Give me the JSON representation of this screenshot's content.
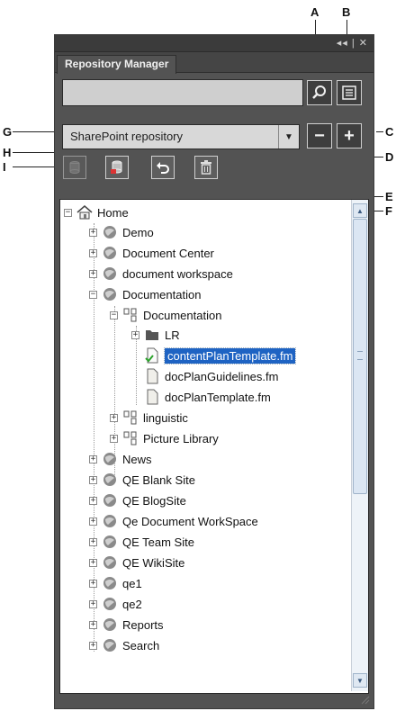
{
  "callouts": {
    "a": "A",
    "b": "B",
    "c": "C",
    "d": "D",
    "e": "E",
    "f": "F",
    "g": "G",
    "h": "H",
    "i": "I"
  },
  "panel": {
    "title_controls": "◂◂ | ✕",
    "tab_label": "Repository Manager",
    "search_value": "",
    "repository_select": "SharePoint repository"
  },
  "tree": {
    "root": "Home",
    "sites": {
      "demo": "Demo",
      "document_center": "Document Center",
      "document_workspace": "document workspace",
      "documentation": "Documentation",
      "documentation_library": "Documentation",
      "lr": "LR",
      "file_selected": "contentPlanTemplate.fm",
      "file_2": "docPlanGuidelines.fm",
      "file_3": "docPlanTemplate.fm",
      "linguistic": "linguistic",
      "picture_library": "Picture Library",
      "news": "News",
      "qe_blank": "QE Blank Site",
      "qe_blog": "QE BlogSite",
      "qe_docws": "Qe Document WorkSpace",
      "qe_team": "QE Team Site",
      "qe_wiki": "QE WikiSite",
      "qe1": "qe1",
      "qe2": "qe2",
      "reports": "Reports",
      "search": "Search"
    }
  },
  "colors": {
    "panel": "#535353",
    "selection": "#1e63c3",
    "globe": "#7a7a7a",
    "checkin": "#2aa22a"
  }
}
